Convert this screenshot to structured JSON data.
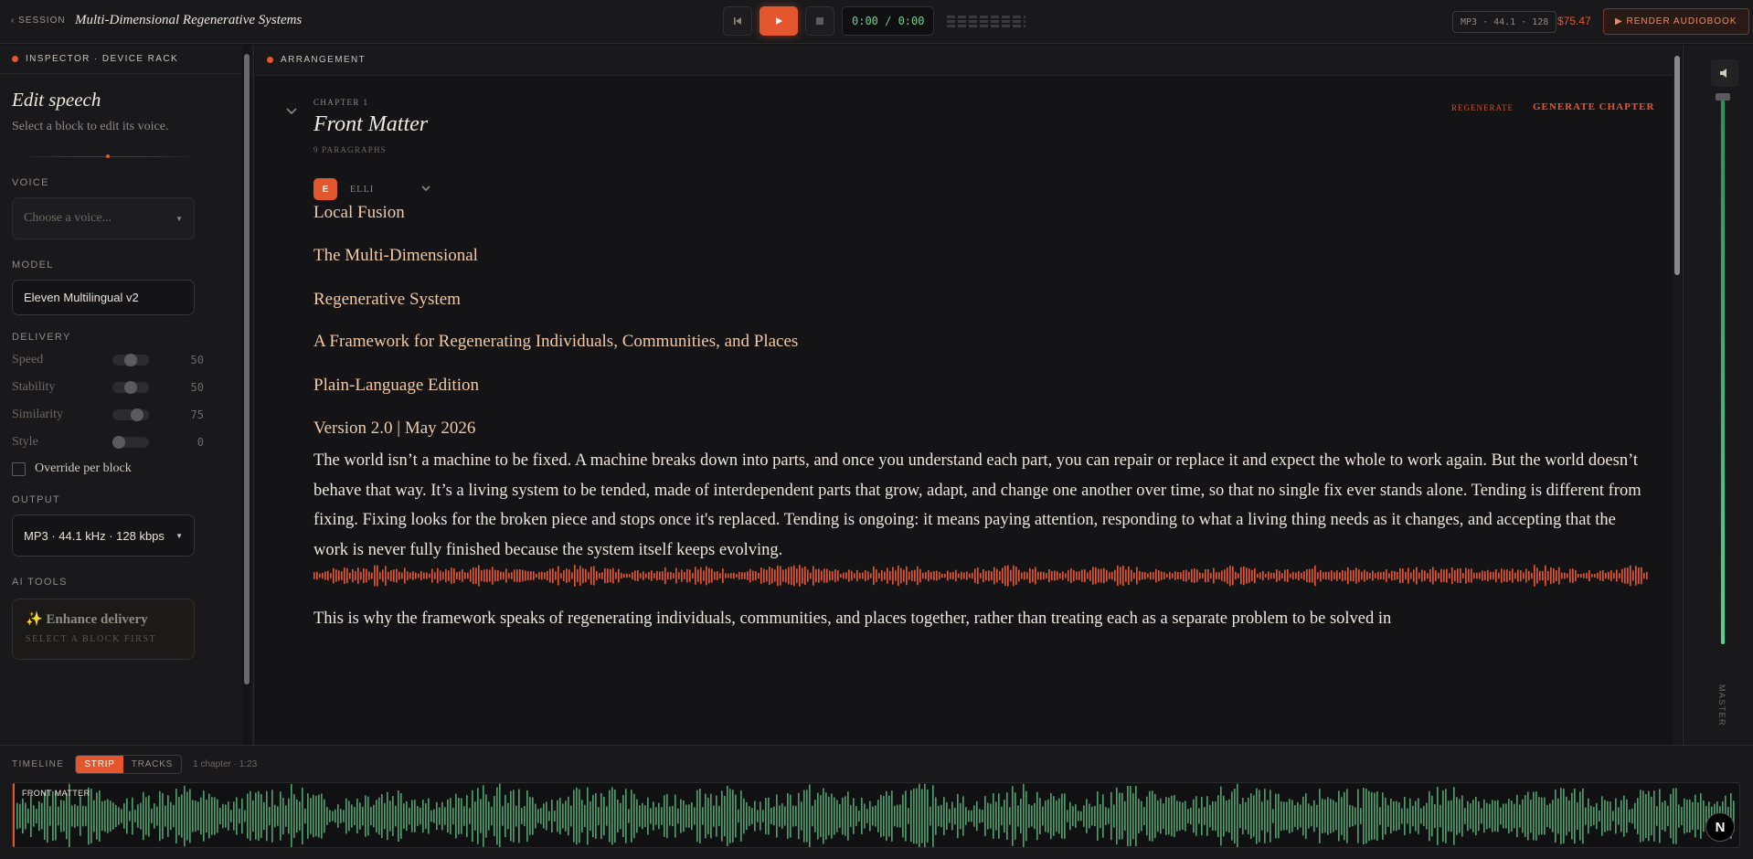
{
  "topbar": {
    "session_link": "‹ SESSION",
    "session_title": "Multi-Dimensional Regenerative Systems",
    "timecode": "0:00 / 0:00",
    "format": "MP3 · 44.1 · 128",
    "price": "$75.47",
    "render_label": "▶ RENDER AUDIOBOOK"
  },
  "inspector": {
    "header": "INSPECTOR · DEVICE RACK",
    "title": "Edit speech",
    "subtitle": "Select a block to edit its voice.",
    "voice_label": "VOICE",
    "voice_placeholder": "Choose a voice...",
    "model_label": "MODEL",
    "model_value": "Eleven Multilingual v2",
    "delivery_label": "DELIVERY",
    "sliders": [
      {
        "label": "Speed",
        "value": "50",
        "level": 0.5
      },
      {
        "label": "Stability",
        "value": "50",
        "level": 0.5
      },
      {
        "label": "Similarity",
        "value": "75",
        "level": 0.75
      },
      {
        "label": "Style",
        "value": "0",
        "level": 0
      }
    ],
    "override_label": "Override per block",
    "output_label": "OUTPUT",
    "output_value": "MP3 · 44.1 kHz · 128 kbps",
    "ai_label": "AI TOOLS",
    "ai_title": "✨ Enhance delivery",
    "ai_sub": "SELECT A BLOCK FIRST"
  },
  "arrangement": {
    "header": "ARRANGEMENT",
    "chapter_num": "CHAPTER 1",
    "chapter_title": "Front Matter",
    "chapter_sub": "9 PARAGRAPHS",
    "regenerate": "REGENERATE",
    "generate_chapter": "GENERATE CHAPTER",
    "voice_initial": "E",
    "voice_name": "ELLI",
    "paragraphs": [
      "Local Fusion",
      "The Multi-Dimensional",
      "Regenerative System",
      "A Framework for Regenerating Individuals, Communities, and Places",
      "Plain-Language Edition",
      "Version 2.0 | May 2026"
    ],
    "body": "The world isn’t a machine to be fixed. A machine breaks down into parts, and once you understand each part, you can repair or replace it and expect the whole to work again. But the world doesn’t behave that way. It’s a living system to be tended, made of interdependent parts that grow, adapt, and change one another over time, so that no single fix ever stands alone. Tending is different from fixing. Fixing looks for the broken piece and stops once it's replaced. Tending is ongoing: it means paying attention, responding to what a living thing needs as it changes, and accepting that the work is never fully finished because the system itself keeps evolving.",
    "body2": "This is why the framework speaks of regenerating individuals, communities, and places together, rather than treating each as a separate problem to be solved in"
  },
  "master": {
    "label": "MASTER",
    "level": 1.0
  },
  "timeline": {
    "label": "TIMELINE",
    "mode_strip": "STRIP",
    "mode_tracks": "TRACKS",
    "meta": "1 chapter · 1:23",
    "clip_label": "FRONT MATTER"
  },
  "badge": "N",
  "colors": {
    "accent": "#e4572e",
    "waveform_timeline": "#4f9f6e",
    "waveform_block": "#e4572e",
    "paragraph_text": "#f0c9a8"
  }
}
